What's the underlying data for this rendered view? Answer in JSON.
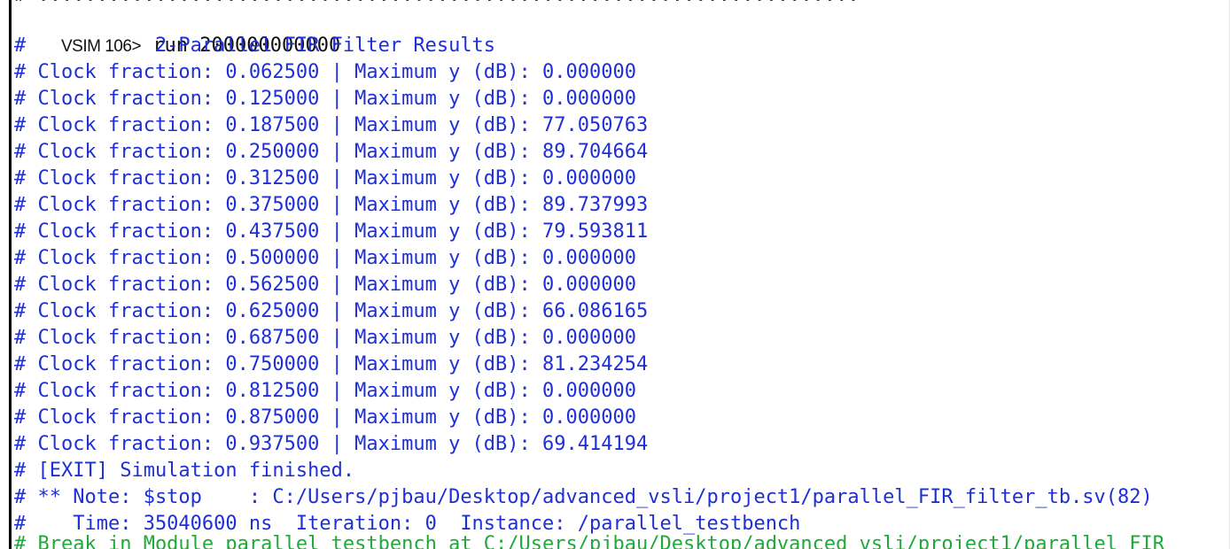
{
  "console": {
    "top_cut_text": "# ......................................................................",
    "command": {
      "prompt": "VSIM 106>",
      "text": " run 200000000000"
    },
    "header": "#           2-Parallel FIR Filter Results",
    "results": [
      "# Clock fraction: 0.062500 | Maximum y (dB): 0.000000",
      "# Clock fraction: 0.125000 | Maximum y (dB): 0.000000",
      "# Clock fraction: 0.187500 | Maximum y (dB): 77.050763",
      "# Clock fraction: 0.250000 | Maximum y (dB): 89.704664",
      "# Clock fraction: 0.312500 | Maximum y (dB): 0.000000",
      "# Clock fraction: 0.375000 | Maximum y (dB): 89.737993",
      "# Clock fraction: 0.437500 | Maximum y (dB): 79.593811",
      "# Clock fraction: 0.500000 | Maximum y (dB): 0.000000",
      "# Clock fraction: 0.562500 | Maximum y (dB): 0.000000",
      "# Clock fraction: 0.625000 | Maximum y (dB): 66.086165",
      "# Clock fraction: 0.687500 | Maximum y (dB): 0.000000",
      "# Clock fraction: 0.750000 | Maximum y (dB): 81.234254",
      "# Clock fraction: 0.812500 | Maximum y (dB): 0.000000",
      "# Clock fraction: 0.875000 | Maximum y (dB): 0.000000",
      "# Clock fraction: 0.937500 | Maximum y (dB): 69.414194"
    ],
    "exit": "# [EXIT] Simulation finished.",
    "note": "# ** Note: $stop    : C:/Users/pjbau/Desktop/advanced_vsli/project1/parallel_FIR_filter_tb.sv(82)",
    "time": "#    Time: 35040600 ns  Iteration: 0  Instance: /parallel_testbench",
    "bottom_cut_text": "# Break in Module parallel_testbench at C:/Users/pjbau/Desktop/advanced_vsli/project1/parallel_FIR"
  },
  "colors": {
    "output_blue": "#1f2fd6",
    "command_black": "#111111",
    "break_green": "#20a83a",
    "background": "#ffffff"
  }
}
